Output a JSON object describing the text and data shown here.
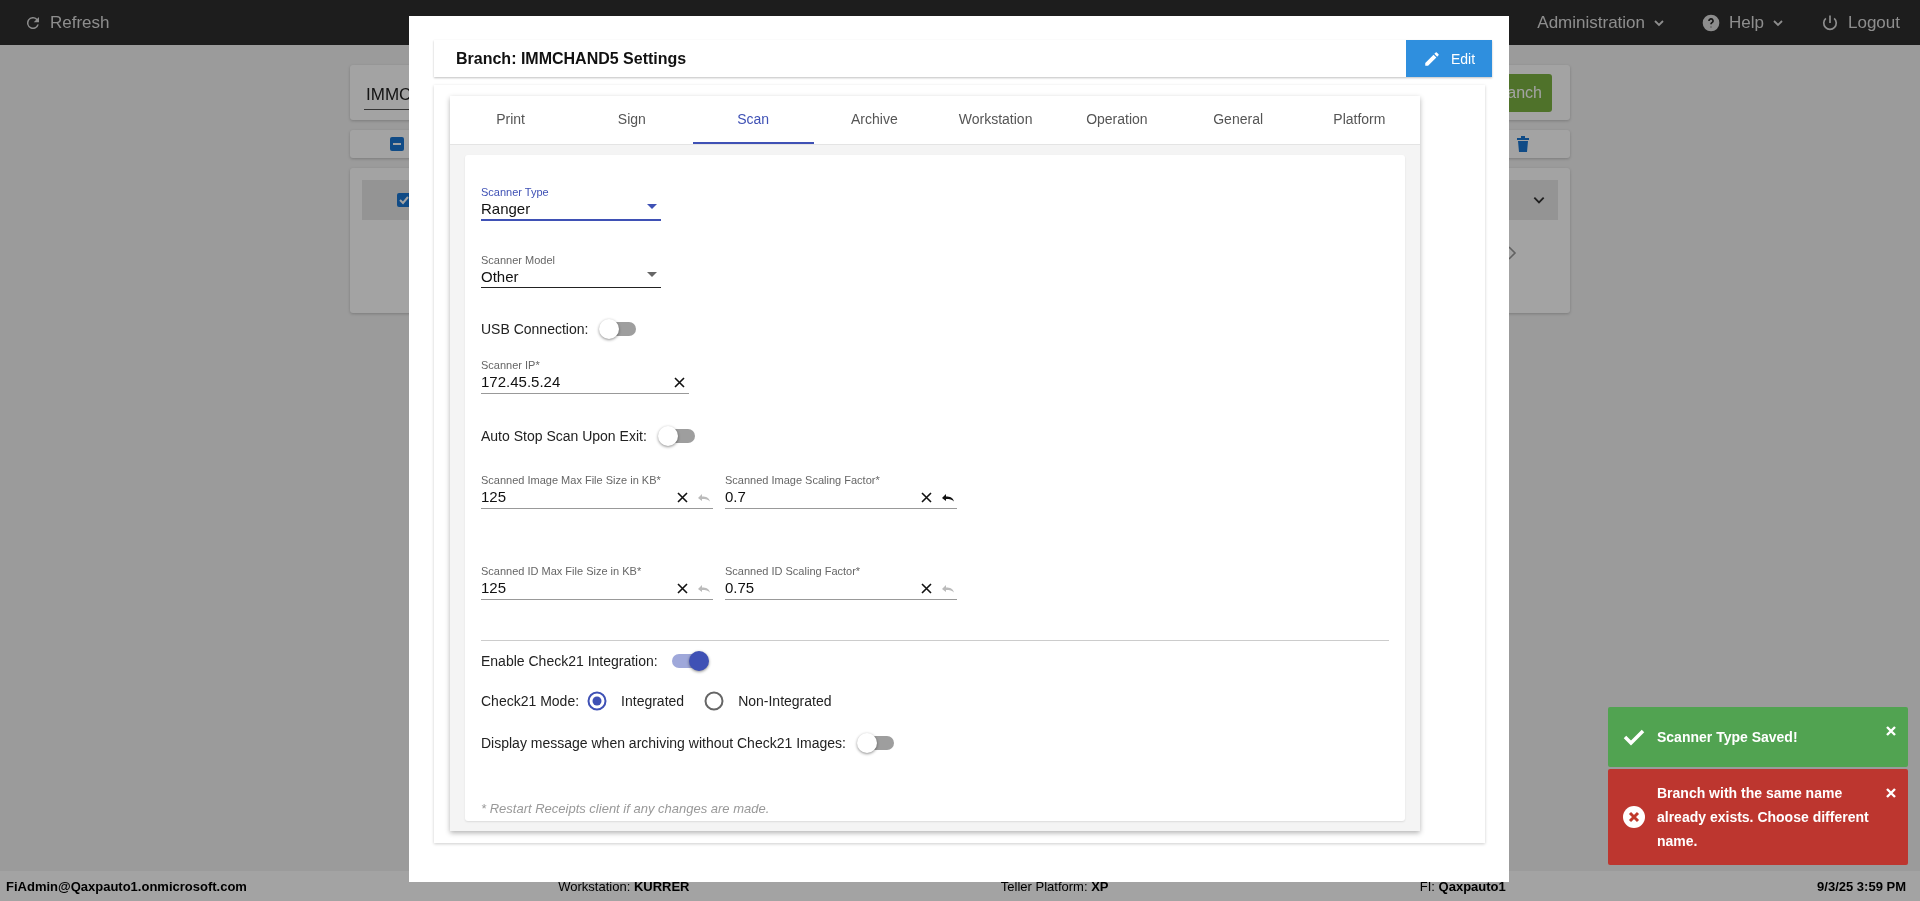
{
  "top_bar": {
    "refresh": "Refresh",
    "menus": [
      {
        "kind": "dropdown",
        "label": "Administration"
      },
      {
        "kind": "help",
        "label": "Help"
      },
      {
        "kind": "logout",
        "label": "Logout"
      }
    ]
  },
  "background": {
    "search_value": "IMMC",
    "search_button": "anch",
    "select_all_indeterminate": true,
    "row_checked": true
  },
  "modal": {
    "title": "Branch: IMMCHAND5 Settings",
    "edit_button": "Edit",
    "tabs": [
      {
        "label": "Print",
        "selected": false
      },
      {
        "label": "Sign",
        "selected": false
      },
      {
        "label": "Scan",
        "selected": true
      },
      {
        "label": "Archive",
        "selected": false
      },
      {
        "label": "Workstation",
        "selected": false
      },
      {
        "label": "Operation",
        "selected": false
      },
      {
        "label": "General",
        "selected": false
      },
      {
        "label": "Platform",
        "selected": false
      }
    ],
    "fields": [
      {
        "kind": "select",
        "label": "Scanner Type",
        "value": "Ranger",
        "focused": true
      },
      {
        "kind": "select",
        "label": "Scanner Model",
        "value": "Other",
        "focused": false
      },
      {
        "kind": "toggle",
        "label": "USB Connection:",
        "on": false
      },
      {
        "kind": "text",
        "label": "Scanner IP*",
        "value": "172.45.5.24",
        "has_undo": false
      },
      {
        "kind": "toggle",
        "label": "Auto Stop Scan Upon Exit:",
        "on": false
      },
      {
        "kind": "pair",
        "items": [
          {
            "label": "Scanned Image Max File Size in KB*",
            "value": "125",
            "has_undo": true,
            "undo_enabled": false
          },
          {
            "label": "Scanned Image Scaling Factor*",
            "value": "0.7",
            "has_undo": true,
            "undo_enabled": true
          }
        ]
      },
      {
        "kind": "pair",
        "items": [
          {
            "label": "Scanned ID Max File Size in KB*",
            "value": "125",
            "has_undo": true,
            "undo_enabled": false
          },
          {
            "label": "Scanned ID Scaling Factor*",
            "value": "0.75",
            "has_undo": true,
            "undo_enabled": false
          }
        ]
      },
      {
        "kind": "divider"
      },
      {
        "kind": "toggle",
        "label": "Enable Check21 Integration:",
        "on": true
      },
      {
        "kind": "radio",
        "label": "Check21 Mode:",
        "options": [
          {
            "label": "Integrated",
            "selected": true
          },
          {
            "label": "Non-Integrated",
            "selected": false
          }
        ]
      },
      {
        "kind": "toggle",
        "label": "Display message when archiving without Check21 Images:",
        "on": false
      }
    ],
    "note": "* Restart Receipts client if any changes are made."
  },
  "toasts": [
    {
      "kind": "success",
      "message": "Scanner Type Saved!"
    },
    {
      "kind": "error",
      "message": "Branch with the same name already exists. Choose different name."
    }
  ],
  "status_bar": {
    "user": "FiAdmin@Qaxpauto1.onmicrosoft.com",
    "fields": [
      "Workstation: **KURRER**",
      "Teller Platform: **XP**",
      "FI: **Qaxpauto1**"
    ],
    "datetime": "9/3/25 3:59 PM"
  }
}
